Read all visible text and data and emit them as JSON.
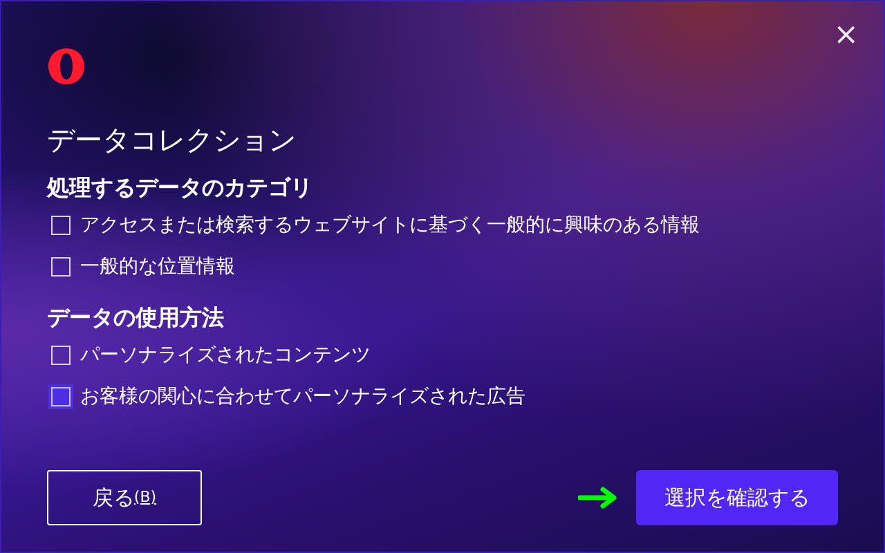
{
  "close_button": "×",
  "title": "データコレクション",
  "sections": [
    {
      "heading": "処理するデータのカテゴリ",
      "options": [
        {
          "label": "アクセスまたは検索するウェブサイトに基づく一般的に興味のある情報",
          "checked": false,
          "focused": false
        },
        {
          "label": "一般的な位置情報",
          "checked": false,
          "focused": false
        }
      ]
    },
    {
      "heading": "データの使用方法",
      "options": [
        {
          "label": "パーソナライズされたコンテンツ",
          "checked": false,
          "focused": false
        },
        {
          "label": "お客様の関心に合わせてパーソナライズされた広告",
          "checked": false,
          "focused": true
        }
      ]
    }
  ],
  "back_button": {
    "label": "戻る",
    "accesskey": "(B)"
  },
  "confirm_button": "選択を確認する"
}
